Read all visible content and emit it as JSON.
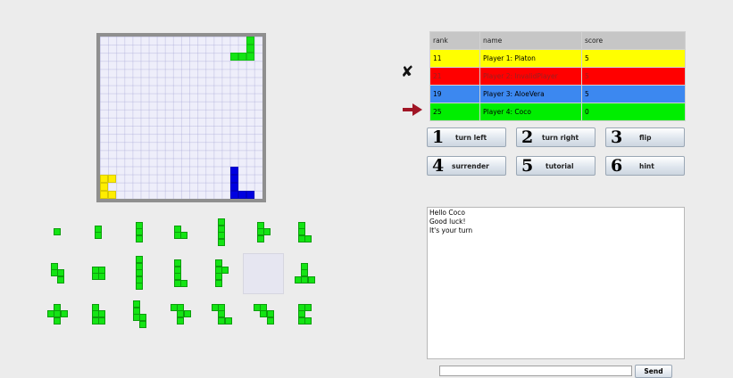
{
  "colors": {
    "board_background": "#eeeefa",
    "yellow_player": "#ffff00",
    "red_player": "#ff0000",
    "blue_player": "#3c88f0",
    "green_player": "#00ee00",
    "piece_green": "#14e414",
    "current_player_arrow": "#a01525"
  },
  "board": {
    "grid_size": 20,
    "pieces": [
      {
        "player": "green",
        "color": "#14e414",
        "cells": [
          [
            18,
            0
          ],
          [
            18,
            1
          ],
          [
            18,
            2
          ],
          [
            16,
            2
          ],
          [
            17,
            2
          ]
        ]
      },
      {
        "player": "yellow",
        "color": "#ffee00",
        "cells": [
          [
            0,
            17
          ],
          [
            1,
            17
          ],
          [
            0,
            18
          ],
          [
            0,
            19
          ],
          [
            1,
            19
          ]
        ]
      },
      {
        "player": "blue",
        "color": "#0000e0",
        "cells": [
          [
            16,
            16
          ],
          [
            16,
            17
          ],
          [
            16,
            18
          ],
          [
            16,
            19
          ],
          [
            17,
            19
          ],
          [
            18,
            19
          ]
        ]
      }
    ]
  },
  "tray": {
    "pieces": [
      [
        [
          0,
          0
        ]
      ],
      [
        [
          0,
          0
        ],
        [
          0,
          1
        ]
      ],
      [
        [
          0,
          0
        ],
        [
          0,
          1
        ],
        [
          0,
          2
        ]
      ],
      [
        [
          0,
          0
        ],
        [
          0,
          1
        ],
        [
          1,
          1
        ]
      ],
      [
        [
          0,
          0
        ],
        [
          0,
          1
        ],
        [
          0,
          2
        ],
        [
          0,
          3
        ]
      ],
      [
        [
          0,
          0
        ],
        [
          0,
          1
        ],
        [
          1,
          1
        ],
        [
          0,
          2
        ]
      ],
      [
        [
          0,
          0
        ],
        [
          0,
          1
        ],
        [
          0,
          2
        ],
        [
          1,
          2
        ]
      ],
      [
        [
          0,
          0
        ],
        [
          0,
          1
        ],
        [
          1,
          1
        ],
        [
          1,
          2
        ]
      ],
      [
        [
          0,
          0
        ],
        [
          1,
          0
        ],
        [
          0,
          1
        ],
        [
          1,
          1
        ]
      ],
      [
        [
          0,
          0
        ],
        [
          0,
          1
        ],
        [
          0,
          2
        ],
        [
          0,
          3
        ],
        [
          0,
          4
        ]
      ],
      [
        [
          0,
          0
        ],
        [
          0,
          1
        ],
        [
          0,
          2
        ],
        [
          0,
          3
        ],
        [
          1,
          3
        ]
      ],
      [
        [
          0,
          0
        ],
        [
          0,
          1
        ],
        [
          1,
          1
        ],
        [
          0,
          2
        ],
        [
          0,
          3
        ]
      ],
      null,
      [
        [
          1,
          0
        ],
        [
          1,
          1
        ],
        [
          0,
          2
        ],
        [
          1,
          2
        ],
        [
          2,
          2
        ]
      ],
      [
        [
          1,
          0
        ],
        [
          0,
          1
        ],
        [
          1,
          1
        ],
        [
          2,
          1
        ],
        [
          1,
          2
        ]
      ],
      [
        [
          0,
          0
        ],
        [
          0,
          1
        ],
        [
          1,
          1
        ],
        [
          0,
          2
        ],
        [
          1,
          2
        ]
      ],
      [
        [
          0,
          0
        ],
        [
          0,
          1
        ],
        [
          0,
          2
        ],
        [
          1,
          2
        ],
        [
          1,
          3
        ]
      ],
      [
        [
          0,
          0
        ],
        [
          1,
          0
        ],
        [
          1,
          1
        ],
        [
          2,
          1
        ],
        [
          1,
          2
        ]
      ],
      [
        [
          0,
          0
        ],
        [
          1,
          0
        ],
        [
          1,
          1
        ],
        [
          1,
          2
        ],
        [
          2,
          2
        ]
      ],
      [
        [
          0,
          0
        ],
        [
          1,
          0
        ],
        [
          1,
          1
        ],
        [
          2,
          1
        ],
        [
          2,
          2
        ]
      ],
      [
        [
          0,
          0
        ],
        [
          1,
          0
        ],
        [
          0,
          1
        ],
        [
          0,
          2
        ],
        [
          1,
          2
        ]
      ]
    ]
  },
  "score_table": {
    "headers": {
      "rank": "rank",
      "name": "name",
      "score": "score"
    },
    "rows": [
      {
        "rank": "11",
        "name": "Player 1: Platon",
        "score": "5"
      },
      {
        "rank": "21",
        "name": "Player 2: InvalidPlayer",
        "score": "5"
      },
      {
        "rank": "19",
        "name": "Player 3: AloeVera",
        "score": "5"
      },
      {
        "rank": "25",
        "name": "Player 4: Coco",
        "score": "0"
      }
    ],
    "eliminated_marker": "✘",
    "current_marker_icon": "arrow-right-icon"
  },
  "buttons": [
    {
      "num": "1",
      "label": "turn left"
    },
    {
      "num": "2",
      "label": "turn right"
    },
    {
      "num": "3",
      "label": "flip"
    },
    {
      "num": "4",
      "label": "surrender"
    },
    {
      "num": "5",
      "label": "tutorial"
    },
    {
      "num": "6",
      "label": "hint"
    }
  ],
  "chat": {
    "lines": [
      "Hello Coco",
      "Good luck!",
      "It's your turn"
    ],
    "input_value": "",
    "send_label": "Send"
  }
}
